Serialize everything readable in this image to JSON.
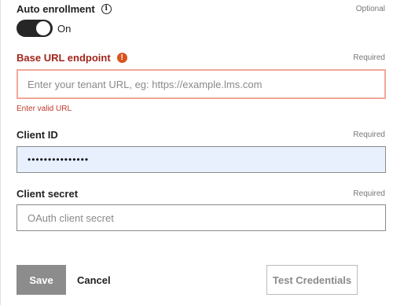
{
  "auto_enrollment": {
    "label": "Auto enrollment",
    "hint": "Optional",
    "toggle_state": "On",
    "info_icon": "info-icon",
    "info_glyph": "i"
  },
  "base_url": {
    "label": "Base URL endpoint",
    "hint": "Required",
    "placeholder": "Enter your tenant URL, eg: https://example.lms.com",
    "value": "",
    "error_message": "Enter valid URL",
    "error_icon": "error-icon",
    "error_glyph": "!"
  },
  "client_id": {
    "label": "Client ID",
    "hint": "Required",
    "masked_value": "•••••••••••••••"
  },
  "client_secret": {
    "label": "Client secret",
    "hint": "Required",
    "placeholder": "OAuth client secret",
    "value": ""
  },
  "actions": {
    "save": "Save",
    "cancel": "Cancel",
    "test": "Test Credentials"
  },
  "colors": {
    "error_text": "#a1261a",
    "error_border": "#f0a898",
    "error_icon_bg": "#d9541e",
    "toggle_on": "#262626",
    "autofill_bg": "#e8f0fe",
    "disabled_button": "#8c8c8c"
  }
}
